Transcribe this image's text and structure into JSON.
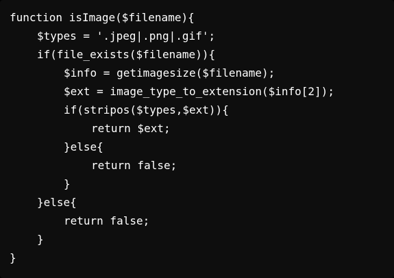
{
  "code": {
    "lines": [
      "function isImage($filename){",
      "$types = '.jpeg|.png|.gif';",
      "if(file_exists($filename)){",
      "$info = getimagesize($filename);",
      "$ext = image_type_to_extension($info[2]);",
      "if(stripos($types,$ext)){",
      "return $ext;",
      "}else{",
      "return false;",
      "}",
      "}else{",
      "return false;",
      "}",
      "}"
    ]
  },
  "colors": {
    "background": "#0e0e0e",
    "text": "#ffffff"
  }
}
